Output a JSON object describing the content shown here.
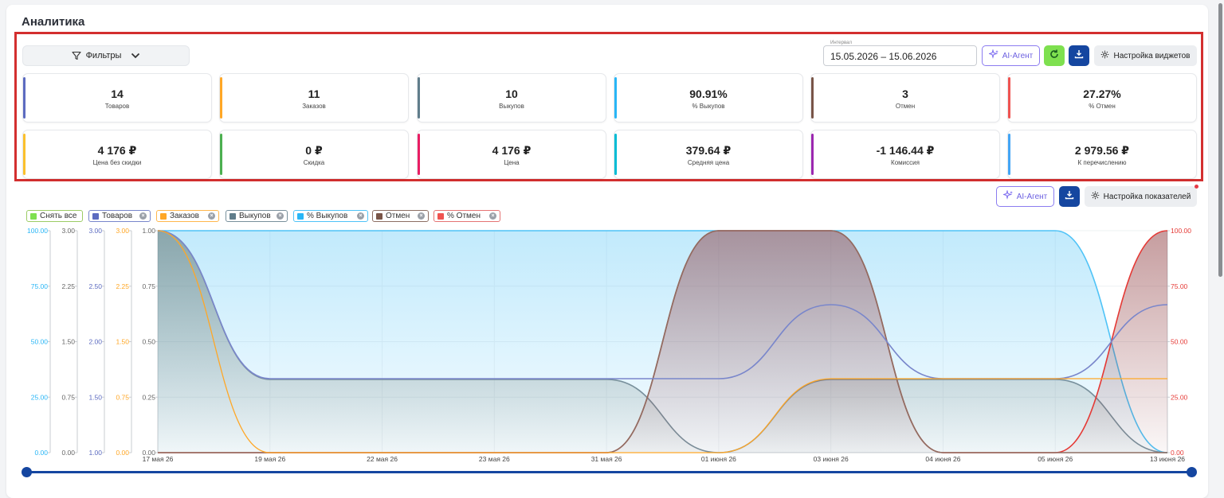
{
  "page": {
    "title": "Аналитика"
  },
  "toolbar": {
    "filters_label": "Фильтры",
    "interval_label": "Интервал",
    "interval_value": "15.05.2026 – 15.06.2026",
    "ai_label": "AI-Агент",
    "widgets_label": "Настройка виджетов"
  },
  "kpis": [
    {
      "value": "14",
      "label": "Товаров",
      "color": "#5c6bc0"
    },
    {
      "value": "11",
      "label": "Заказов",
      "color": "#ffa726"
    },
    {
      "value": "10",
      "label": "Выкупов",
      "color": "#607d8b"
    },
    {
      "value": "90.91%",
      "label": "% Выкупов",
      "color": "#29b6f6"
    },
    {
      "value": "3",
      "label": "Отмен",
      "color": "#795548"
    },
    {
      "value": "27.27%",
      "label": "% Отмен",
      "color": "#ef5350"
    },
    {
      "value": "4 176 ₽",
      "label": "Цена без скидки",
      "color": "#fbc02d"
    },
    {
      "value": "0 ₽",
      "label": "Скидка",
      "color": "#4caf50"
    },
    {
      "value": "4 176 ₽",
      "label": "Цена",
      "color": "#e91e63"
    },
    {
      "value": "379.64 ₽",
      "label": "Средняя цена",
      "color": "#00bcd4"
    },
    {
      "value": "-1 146.44 ₽",
      "label": "Комиссия",
      "color": "#9c27b0"
    },
    {
      "value": "2 979.56 ₽",
      "label": "К перечислению",
      "color": "#42a5f5"
    }
  ],
  "chart_toolbar": {
    "ai_label": "AI-Агент",
    "settings_label": "Настройка показателей"
  },
  "legend": [
    {
      "label": "Снять все",
      "color": "#7ee04f",
      "border": "#9ccc65",
      "removable": false
    },
    {
      "label": "Товаров",
      "color": "#5c6bc0",
      "border": "#7986cb",
      "removable": true
    },
    {
      "label": "Заказов",
      "color": "#ffa726",
      "border": "#ffb74d",
      "removable": true
    },
    {
      "label": "Выкупов",
      "color": "#607d8b",
      "border": "#78909c",
      "removable": true
    },
    {
      "label": "% Выкупов",
      "color": "#29b6f6",
      "border": "#4fc3f7",
      "removable": true
    },
    {
      "label": "Отмен",
      "color": "#795548",
      "border": "#8d6e63",
      "removable": true
    },
    {
      "label": "% Отмен",
      "color": "#ef5350",
      "border": "#e57373",
      "removable": true
    }
  ],
  "chart_data": {
    "type": "area",
    "categories": [
      "17 мая 26",
      "19 мая 26",
      "22 мая 26",
      "23 мая 26",
      "31 мая 26",
      "01 июня 26",
      "03 июня 26",
      "04 июня 26",
      "05 июня 26",
      "13 июня 26"
    ],
    "series": [
      {
        "name": "Товаров",
        "color": "#7986cb",
        "axis": "Товаров",
        "values": [
          3,
          1,
          1,
          1,
          1,
          1,
          2,
          1,
          1,
          2
        ]
      },
      {
        "name": "Заказов",
        "color": "#ffa726",
        "axis": "Заказов",
        "values": [
          3,
          0,
          0,
          0,
          0,
          0,
          1,
          1,
          1,
          1
        ]
      },
      {
        "name": "Выкупов",
        "color": "#78909c",
        "axis": "Выкупов",
        "values": [
          1,
          0.33,
          0.33,
          0.33,
          0.33,
          0,
          0.33,
          0.33,
          0.33,
          0
        ]
      },
      {
        "name": "% Выкупов",
        "color": "#4fc3f7",
        "axis": "% Выкупов",
        "values": [
          100,
          100,
          100,
          100,
          100,
          100,
          100,
          100,
          100,
          0
        ]
      },
      {
        "name": "Отмен",
        "color": "#8d6e63",
        "axis": "Выкупов",
        "values": [
          0,
          0,
          0,
          0,
          0,
          1,
          1,
          0,
          0,
          0
        ]
      },
      {
        "name": "% Отмен",
        "color": "#e53935",
        "axis": "% Отмен",
        "values": [
          0,
          0,
          0,
          0,
          0,
          100,
          100,
          0,
          0,
          100
        ]
      }
    ],
    "axes": [
      {
        "name": "% Выкупов",
        "color": "#29b6f6",
        "ticks": [
          "100.00",
          "75.00",
          "50.00",
          "25.00",
          "0.00"
        ]
      },
      {
        "name": "Товаров",
        "color": "#666666",
        "ticks": [
          "3.00",
          "2.25",
          "1.50",
          "0.75",
          "0.00"
        ]
      },
      {
        "name": "Товаров-2",
        "color": "#5c6bc0",
        "ticks": [
          "3.00",
          "2.50",
          "2.00",
          "1.50",
          "1.00"
        ]
      },
      {
        "name": "Заказов",
        "color": "#ffa726",
        "ticks": [
          "3.00",
          "2.25",
          "1.50",
          "0.75",
          "0.00"
        ]
      },
      {
        "name": "Выкупов",
        "color": "#666666",
        "ticks": [
          "1.00",
          "0.75",
          "0.50",
          "0.25",
          "0.00"
        ]
      },
      {
        "name": "% Отмен",
        "color": "#e53935",
        "ticks": [
          "100.00",
          "75.00",
          "50.00",
          "25.00",
          "0.00"
        ]
      }
    ],
    "grid": true,
    "legend_position": "top-left"
  }
}
